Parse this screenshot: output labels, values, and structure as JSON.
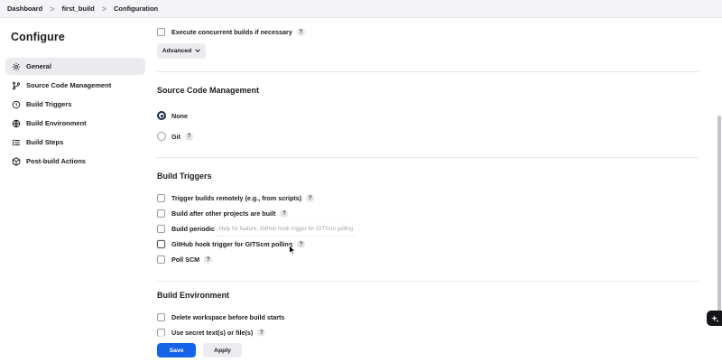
{
  "breadcrumb": {
    "items": [
      {
        "label": "Dashboard"
      },
      {
        "label": "first_build"
      },
      {
        "label": "Configuration"
      }
    ],
    "separator": ">"
  },
  "sidebar": {
    "title": "Configure",
    "items": [
      {
        "label": "General",
        "icon": "gear-icon",
        "active": true
      },
      {
        "label": "Source Code Management",
        "icon": "branch-icon"
      },
      {
        "label": "Build Triggers",
        "icon": "clock-icon"
      },
      {
        "label": "Build Environment",
        "icon": "globe-icon"
      },
      {
        "label": "Build Steps",
        "icon": "list-icon"
      },
      {
        "label": "Post-build Actions",
        "icon": "box-icon"
      }
    ]
  },
  "general": {
    "concurrent_label": "Execute concurrent builds if necessary",
    "advanced_label": "Advanced",
    "advanced_icon": "chevron-down-icon"
  },
  "scm": {
    "title": "Source Code Management",
    "options": [
      {
        "label": "None",
        "selected": true
      },
      {
        "label": "Git",
        "selected": false
      }
    ]
  },
  "triggers": {
    "title": "Build Triggers",
    "items": [
      {
        "label": "Trigger builds remotely (e.g., from scripts)"
      },
      {
        "label": "Build after other projects are built"
      },
      {
        "label": "Build periodically"
      },
      {
        "label": "GitHub hook trigger for GITScm polling"
      },
      {
        "label": "Poll SCM"
      }
    ],
    "tooltip": "Help for feature: GitHub hook trigger for GITScm polling"
  },
  "environment": {
    "title": "Build Environment",
    "items": [
      {
        "label": "Delete workspace before build starts"
      },
      {
        "label": "Use secret text(s) or file(s)"
      }
    ]
  },
  "help_symbol": "?",
  "actions": {
    "save_label": "Save",
    "apply_label": "Apply"
  },
  "colors": {
    "primary": "#1563e8",
    "sidebar_active": "#ebebef",
    "radio_checked": "#1b2b4d"
  }
}
